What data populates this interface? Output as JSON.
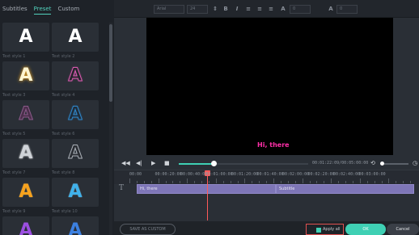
{
  "tabs": [
    "Subtitles",
    "Preset",
    "Custom"
  ],
  "styles": [
    {
      "letter": "A",
      "label": "Text style 1",
      "color": "#ffffff",
      "shadow": "none"
    },
    {
      "letter": "A",
      "label": "Text style 2",
      "color": "#ffffff",
      "shadow": "none"
    },
    {
      "letter": "A",
      "label": "Text style 3",
      "color": "#fff6d2",
      "shadow": "0 0 4px #ffb326"
    },
    {
      "letter": "A",
      "label": "Text style 4",
      "color": "#24252b",
      "shadow": "0 0 2px #d95ab0"
    },
    {
      "letter": "A",
      "label": "Text style 5",
      "color": "#4b2f4b",
      "shadow": "0 0 1px #8b5a8a"
    },
    {
      "letter": "A",
      "label": "Text style 6",
      "color": "#1f2c3a",
      "shadow": "0 0 2px #2f86c9"
    },
    {
      "letter": "A",
      "label": "Text style 7",
      "color": "#cfd3d8",
      "shadow": "0 0 2px #ffffff"
    },
    {
      "letter": "A",
      "label": "Text style 8",
      "color": "#2a2d33",
      "shadow": "0 0 1px #aab0b7"
    },
    {
      "letter": "A",
      "label": "Text style 9",
      "color": "#f7a21d",
      "shadow": "0 0 1px #ffd27a"
    },
    {
      "letter": "A",
      "label": "Text style 10",
      "color": "#3fb1ea",
      "shadow": "0 0 1px #9fe0ff"
    },
    {
      "letter": "A",
      "label": "",
      "color": "#9b4fe0",
      "shadow": "none"
    },
    {
      "letter": "A",
      "label": "",
      "color": "#3c80e0",
      "shadow": "none"
    }
  ],
  "toolbar": {
    "font": "Arial",
    "size": "24",
    "spacing": "0",
    "line": "0"
  },
  "preview": {
    "text": "Hi, there"
  },
  "player": {
    "timecode": "00:01:22:09/00:05:00:00"
  },
  "ruler": [
    "00:00",
    "00:00:20:00",
    "00:00:40:00",
    "00:01:00:00",
    "00:01:20:00",
    "00:01:40:00",
    "00:02:00:00",
    "00:02:20:00",
    "00:02:40:00",
    "00:03:00:00"
  ],
  "clips": [
    {
      "label": "Hi, there"
    },
    {
      "label": "Subtitle"
    }
  ],
  "footer": {
    "save": "SAVE AS CUSTOM",
    "apply_all": "Apply all",
    "ok": "OK",
    "cancel": "Cancel"
  }
}
